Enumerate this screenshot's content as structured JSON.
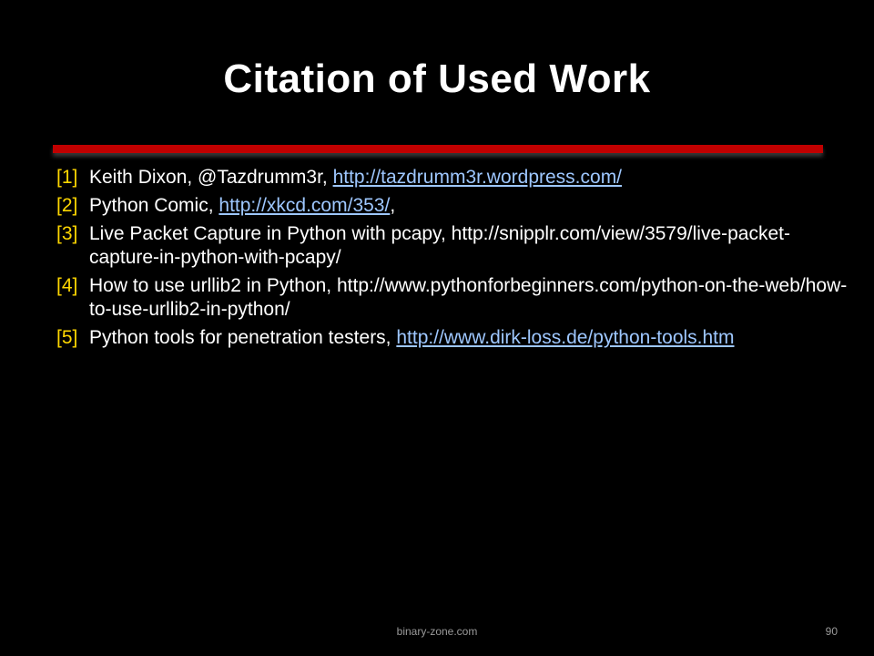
{
  "title": "Citation of Used Work",
  "accent_color": "#c00000",
  "number_color": "#ffd700",
  "link_color": "#9ec7ff",
  "refs": [
    {
      "num": "[1]",
      "text": "Keith Dixon, @Tazdrumm3r, ",
      "link": "http://tazdrumm3r.wordpress.com/",
      "tail": ""
    },
    {
      "num": "[2]",
      "text": "Python Comic, ",
      "link": "http://xkcd.com/353/",
      "tail": ","
    },
    {
      "num": "[3]",
      "text": "Live Packet Capture in Python with pcapy, http://snipplr.com/view/3579/live-packet-capture-in-python-with-pcapy/",
      "link": "",
      "tail": ""
    },
    {
      "num": "[4]",
      "text": "How to use urllib2 in Python, http://www.pythonforbeginners.com/python-on-the-web/how-to-use-urllib2-in-python/",
      "link": "",
      "tail": ""
    },
    {
      "num": "[5]",
      "text": "Python tools for penetration testers, ",
      "link": "http://www.dirk-loss.de/python-tools.htm",
      "tail": ""
    }
  ],
  "footer": "binary-zone.com",
  "page_number": "90"
}
